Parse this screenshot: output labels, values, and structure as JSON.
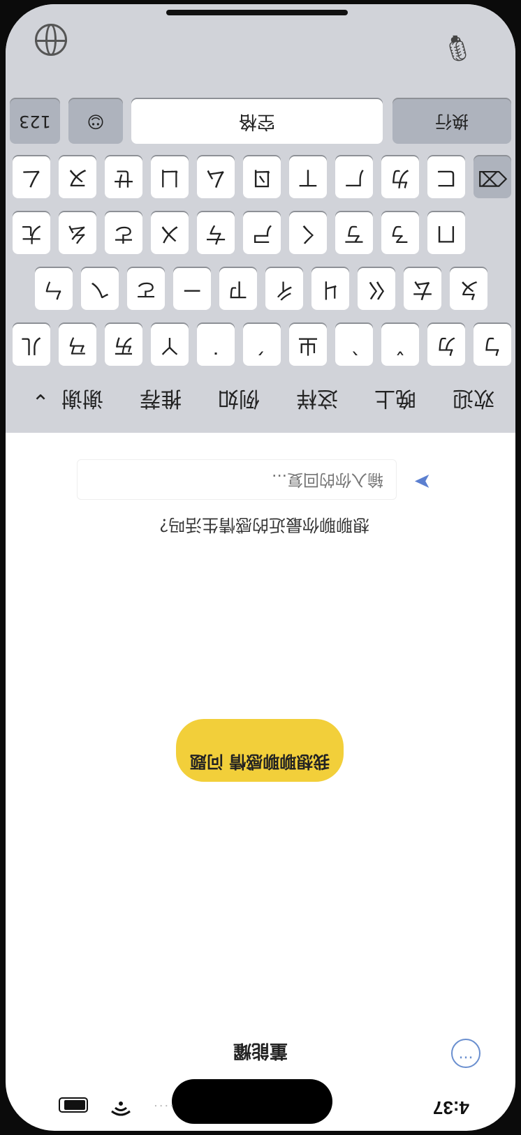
{
  "status": {
    "time": "4:37",
    "signal": "····"
  },
  "header": {
    "title": "董能耀",
    "more_icon": "ellipsis-circle-icon"
  },
  "chat": {
    "bubble": "我想聊聊感情 问题",
    "prompt": "想聊聊你最近的感情生活吗？",
    "input_placeholder": "输入你的回复..."
  },
  "keyboard": {
    "candidates": [
      "欢迎",
      "晚上",
      "这样",
      "例如",
      "推荐",
      "谢谢"
    ],
    "row1": [
      "ㄅ",
      "ㄉ",
      "ˇ",
      "ˋ",
      "ㄓ",
      "ˊ",
      "˙",
      "ㄚ",
      "ㄞ",
      "ㄢ",
      "ㄦ"
    ],
    "row2": [
      "ㄆ",
      "ㄊ",
      "ㄍ",
      "ㄐ",
      "ㄔ",
      "ㄗ",
      "ㄧ",
      "ㄛ",
      "ㄟ",
      "ㄣ"
    ],
    "row3": [
      "ㄇ",
      "ㄋ",
      "ㄎ",
      "ㄑ",
      "ㄕ",
      "ㄘ",
      "ㄨ",
      "ㄜ",
      "ㄠ",
      "ㄤ"
    ],
    "row4": [
      "ㄈ",
      "ㄌ",
      "ㄏ",
      "ㄒ",
      "ㄖ",
      "ㄙ",
      "ㄩ",
      "ㄝ",
      "ㄡ",
      "ㄥ"
    ],
    "num_key": "123",
    "space_key": "空格",
    "return_key": "换行",
    "collapse_icon": "chevron-down-icon",
    "delete_icon": "delete-icon"
  },
  "colors": {
    "bubble": "#f2cf3a",
    "accent": "#5b7fd0",
    "keyboard_bg": "#d1d3d9"
  }
}
